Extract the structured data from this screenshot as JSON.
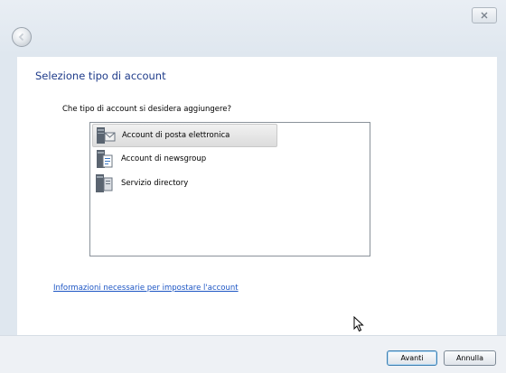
{
  "window": {
    "close_icon": "close-icon",
    "back_icon": "back-arrow-icon"
  },
  "main": {
    "heading": "Selezione tipo di account",
    "question": "Che tipo di account si desidera aggiungere?",
    "account_types": [
      {
        "label": "Account di posta elettronica",
        "icon": "email-account-icon",
        "selected": true
      },
      {
        "label": "Account di newsgroup",
        "icon": "newsgroup-account-icon",
        "selected": false
      },
      {
        "label": "Servizio directory",
        "icon": "directory-service-icon",
        "selected": false
      }
    ],
    "info_link": "Informazioni necessarie per impostare l'account"
  },
  "footer": {
    "next_label": "Avanti",
    "cancel_label": "Annulla"
  },
  "colors": {
    "heading": "#1e3b8a",
    "link": "#1c55c4",
    "chrome": "#dfe7ef"
  }
}
